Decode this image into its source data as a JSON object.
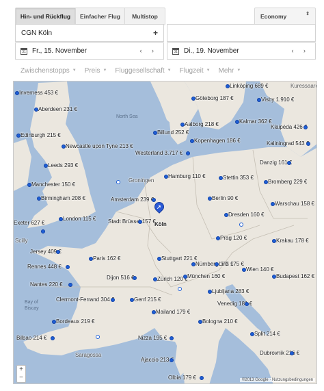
{
  "trip_tabs": [
    "Hin- und Rückflug",
    "Einfacher Flug",
    "Multistop"
  ],
  "cabin": {
    "value": "Economy",
    "arrows": "⇕"
  },
  "origin": {
    "value": "CGN Köln",
    "plus": "+"
  },
  "destination": {
    "value": ""
  },
  "dates": {
    "depart": "Fr., 15. November",
    "return": "Di., 19. November",
    "calendar_glyph": "31",
    "nav": "‹ ›"
  },
  "filters": [
    "Zwischenstopps",
    "Preis",
    "Fluggesellschaft",
    "Flugzeit",
    "Mehr"
  ],
  "map": {
    "seas": {
      "north_sea": "North Sea",
      "bay": "Bay of Biscay"
    },
    "country_labels": [
      "Kuressaare",
      "Groningen",
      "Saragossa",
      "Scilly"
    ],
    "cities": [
      "Inverness 453 €",
      "Aberdeen 231 €",
      "Edinburgh 215 €",
      "Newcastle upon Tyne 213 €",
      "Leeds 293 €",
      "Manchester 150 €",
      "Birmingham 208 €",
      "London 115 €",
      "Exeter 627 €",
      "Linköping 689 €",
      "Göteborg 187 €",
      "Visby 1.910 €",
      "Kalmar 362 €",
      "Billund 252 €",
      "Aalborg 218 €",
      "Kopenhagen 186 €",
      "Klaipėda 426 €",
      "Kaliningrad 543 €",
      "Westerland 3.717 €",
      "Danzig 161 €",
      "Hamburg 110 €",
      "Stettin 353 €",
      "Bromberg 229 €",
      "Amsterdam 239 €",
      "Berlin 90 €",
      "Warschau 158 €",
      "Stadt Brüssel 157 €",
      "Köln",
      "Dresden 160 €",
      "Prag 120 €",
      "Krakau 178 €",
      "Jersey 409 €",
      "Rennes 448 €",
      "Paris 162 €",
      "Stuttgart 221 €",
      "Nürnberg 175 €",
      "Dijon 516 €",
      "Linz 175 €",
      "Wien 140 €",
      "Nantes 220 €",
      "München 160 €",
      "Zürich 120 €",
      "Budapest 162 €",
      "Clermont-Ferrand 304 €",
      "Genf 215 €",
      "Ljubljana 283 €",
      "Venedig 181 €",
      "Bordeaux 219 €",
      "Mailand 179 €",
      "Bologna 210 €",
      "Split 214 €",
      "Bilbao 214 €",
      "Nizza 195 €",
      "Dubrovnik 216 €",
      "Ajaccio 213 €",
      "Olbia 179 €"
    ],
    "zoom_plus": "+",
    "zoom_minus": "−",
    "copyright": "©2013 Google · Nutzungsbedingungen"
  }
}
